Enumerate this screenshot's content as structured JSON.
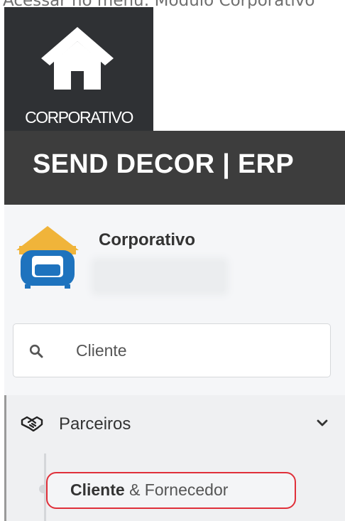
{
  "caption": "Acessar no menu: Módulo Corporativo",
  "module_tile": {
    "label": "CORPORATIVO",
    "icon": "home-icon",
    "bg_color": "#2f3134"
  },
  "header": {
    "title": "SEND DECOR | ERP",
    "bg_color": "#3d3d3d"
  },
  "sidebar": {
    "module_name": "Corporativo",
    "logo_icon": "sofa-house-logo",
    "search": {
      "value": "Cliente",
      "icon": "search-icon"
    },
    "menu": {
      "parent": {
        "label": "Parceiros",
        "icon": "handshake-icon",
        "expand_icon": "chevron-down-icon"
      },
      "child": {
        "label_bold": "Cliente",
        "label_rest": " & Fornecedor",
        "highlight_color": "#e0303a"
      }
    }
  }
}
